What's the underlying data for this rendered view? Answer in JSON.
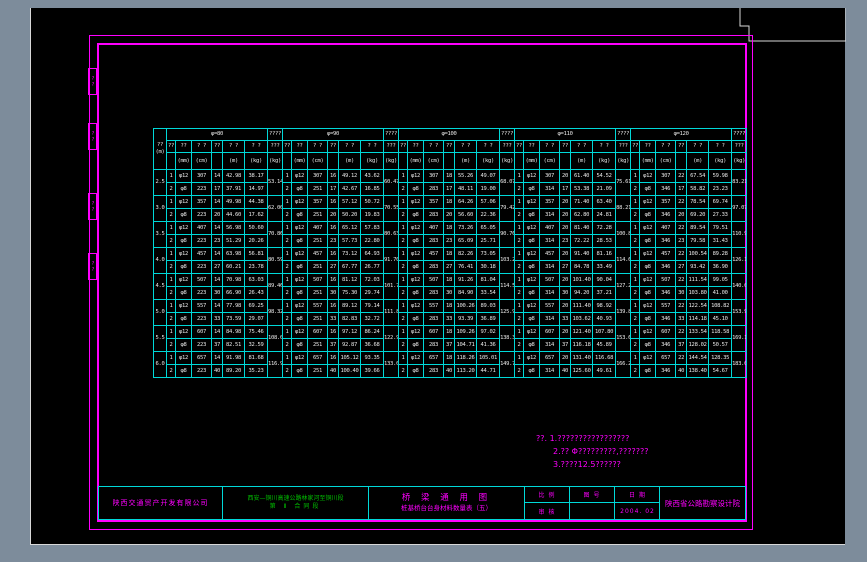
{
  "colors": {
    "desktop_background": "#7D8C9B",
    "drawing_background": "#000000",
    "frame": "#FF00FF",
    "grid": "#00D8D8",
    "table_text": "#E8E8E8",
    "note_text": "#FF00FF",
    "project_text": "#00C000"
  },
  "margin_tabs": [
    "??",
    "??",
    "??",
    "??"
  ],
  "table": {
    "corner_label": "??",
    "corner_unit": "(m)",
    "total_top": "????",
    "total_label": "???",
    "total_unit": "(kg)",
    "col_labels": [
      "??",
      "??",
      "? ?",
      "??",
      "? ?",
      "? ?"
    ],
    "col_units": [
      "",
      "(mm)",
      "(cm)",
      "",
      "(m)",
      "(kg)"
    ],
    "row_labels": [
      "2.5",
      "3.0",
      "3.5",
      "4.0",
      "4.5",
      "5.0",
      "5.5",
      "6.0"
    ],
    "groups": [
      {
        "title": "φ=80",
        "pairs": [
          {
            "r1": [
              "1",
              "φ12",
              "307",
              "14",
              "42.98",
              "38.17"
            ],
            "r2": [
              "2",
              "φ8",
              "223",
              "17",
              "37.91",
              "14.97"
            ],
            "sum": "53.14"
          },
          {
            "r1": [
              "1",
              "φ12",
              "357",
              "14",
              "49.98",
              "44.38"
            ],
            "r2": [
              "2",
              "φ8",
              "223",
              "20",
              "44.60",
              "17.62"
            ],
            "sum": "62.00"
          },
          {
            "r1": [
              "1",
              "φ12",
              "407",
              "14",
              "56.98",
              "50.60"
            ],
            "r2": [
              "2",
              "φ8",
              "223",
              "23",
              "51.29",
              "20.26"
            ],
            "sum": "70.86"
          },
          {
            "r1": [
              "1",
              "φ12",
              "457",
              "14",
              "63.98",
              "56.81"
            ],
            "r2": [
              "2",
              "φ8",
              "223",
              "27",
              "60.21",
              "23.78"
            ],
            "sum": "80.59"
          },
          {
            "r1": [
              "1",
              "φ12",
              "507",
              "14",
              "70.98",
              "63.03"
            ],
            "r2": [
              "2",
              "φ8",
              "223",
              "30",
              "66.90",
              "26.43"
            ],
            "sum": "89.46"
          },
          {
            "r1": [
              "1",
              "φ12",
              "557",
              "14",
              "77.98",
              "69.25"
            ],
            "r2": [
              "2",
              "φ8",
              "223",
              "33",
              "73.59",
              "29.07"
            ],
            "sum": "98.32"
          },
          {
            "r1": [
              "1",
              "φ12",
              "607",
              "14",
              "84.98",
              "75.46"
            ],
            "r2": [
              "2",
              "φ8",
              "223",
              "37",
              "82.51",
              "32.59"
            ],
            "sum": "108.05"
          },
          {
            "r1": [
              "1",
              "φ12",
              "657",
              "14",
              "91.98",
              "81.68"
            ],
            "r2": [
              "2",
              "φ8",
              "223",
              "40",
              "89.20",
              "35.23"
            ],
            "sum": "116.91"
          }
        ]
      },
      {
        "title": "φ=90",
        "pairs": [
          {
            "r1": [
              "1",
              "φ12",
              "307",
              "16",
              "49.12",
              "43.62"
            ],
            "r2": [
              "2",
              "φ8",
              "251",
              "17",
              "42.67",
              "16.85"
            ],
            "sum": "60.47"
          },
          {
            "r1": [
              "1",
              "φ12",
              "357",
              "16",
              "57.12",
              "50.72"
            ],
            "r2": [
              "2",
              "φ8",
              "251",
              "20",
              "50.20",
              "19.83"
            ],
            "sum": "70.55"
          },
          {
            "r1": [
              "1",
              "φ12",
              "407",
              "16",
              "65.12",
              "57.83"
            ],
            "r2": [
              "2",
              "φ8",
              "251",
              "23",
              "57.73",
              "22.80"
            ],
            "sum": "80.63"
          },
          {
            "r1": [
              "1",
              "φ12",
              "457",
              "16",
              "73.12",
              "64.93"
            ],
            "r2": [
              "2",
              "φ8",
              "251",
              "27",
              "67.77",
              "26.77"
            ],
            "sum": "91.70"
          },
          {
            "r1": [
              "1",
              "φ12",
              "507",
              "16",
              "81.12",
              "72.03"
            ],
            "r2": [
              "2",
              "φ8",
              "251",
              "30",
              "75.30",
              "29.74"
            ],
            "sum": "101.77"
          },
          {
            "r1": [
              "1",
              "φ12",
              "557",
              "16",
              "89.12",
              "79.14"
            ],
            "r2": [
              "2",
              "φ8",
              "251",
              "33",
              "82.83",
              "32.72"
            ],
            "sum": "111.86"
          },
          {
            "r1": [
              "1",
              "φ12",
              "607",
              "16",
              "97.12",
              "86.24"
            ],
            "r2": [
              "2",
              "φ8",
              "251",
              "37",
              "92.87",
              "36.68"
            ],
            "sum": "122.92"
          },
          {
            "r1": [
              "1",
              "φ12",
              "657",
              "16",
              "105.12",
              "93.35"
            ],
            "r2": [
              "2",
              "φ8",
              "251",
              "40",
              "100.40",
              "39.66"
            ],
            "sum": "133.01"
          }
        ]
      },
      {
        "title": "φ=100",
        "pairs": [
          {
            "r1": [
              "1",
              "φ12",
              "307",
              "18",
              "55.26",
              "49.07"
            ],
            "r2": [
              "2",
              "φ8",
              "283",
              "17",
              "48.11",
              "19.00"
            ],
            "sum": "68.07"
          },
          {
            "r1": [
              "1",
              "φ12",
              "357",
              "18",
              "64.26",
              "57.06"
            ],
            "r2": [
              "2",
              "φ8",
              "283",
              "20",
              "56.60",
              "22.36"
            ],
            "sum": "79.42"
          },
          {
            "r1": [
              "1",
              "φ12",
              "407",
              "18",
              "73.26",
              "65.05"
            ],
            "r2": [
              "2",
              "φ8",
              "283",
              "23",
              "65.09",
              "25.71"
            ],
            "sum": "90.76"
          },
          {
            "r1": [
              "1",
              "φ12",
              "457",
              "18",
              "82.26",
              "73.05"
            ],
            "r2": [
              "2",
              "φ8",
              "283",
              "27",
              "76.41",
              "30.18"
            ],
            "sum": "103.23"
          },
          {
            "r1": [
              "1",
              "φ12",
              "507",
              "18",
              "91.26",
              "81.04"
            ],
            "r2": [
              "2",
              "φ8",
              "283",
              "30",
              "84.90",
              "33.54"
            ],
            "sum": "114.58"
          },
          {
            "r1": [
              "1",
              "φ12",
              "557",
              "18",
              "100.26",
              "89.03"
            ],
            "r2": [
              "2",
              "φ8",
              "283",
              "33",
              "93.39",
              "36.89"
            ],
            "sum": "125.92"
          },
          {
            "r1": [
              "1",
              "φ12",
              "607",
              "18",
              "109.26",
              "97.02"
            ],
            "r2": [
              "2",
              "φ8",
              "283",
              "37",
              "104.71",
              "41.36"
            ],
            "sum": "138.38"
          },
          {
            "r1": [
              "1",
              "φ12",
              "657",
              "18",
              "118.26",
              "105.01"
            ],
            "r2": [
              "2",
              "φ8",
              "283",
              "40",
              "113.20",
              "44.71"
            ],
            "sum": "149.72"
          }
        ]
      },
      {
        "title": "φ=110",
        "pairs": [
          {
            "r1": [
              "1",
              "φ12",
              "307",
              "20",
              "61.40",
              "54.52"
            ],
            "r2": [
              "2",
              "φ8",
              "314",
              "17",
              "53.38",
              "21.09"
            ],
            "sum": "75.61"
          },
          {
            "r1": [
              "1",
              "φ12",
              "357",
              "20",
              "71.40",
              "63.40"
            ],
            "r2": [
              "2",
              "φ8",
              "314",
              "20",
              "62.80",
              "24.81"
            ],
            "sum": "88.21"
          },
          {
            "r1": [
              "1",
              "φ12",
              "407",
              "20",
              "81.40",
              "72.28"
            ],
            "r2": [
              "2",
              "φ8",
              "314",
              "23",
              "72.22",
              "28.53"
            ],
            "sum": "100.81"
          },
          {
            "r1": [
              "1",
              "φ12",
              "457",
              "20",
              "91.40",
              "81.16"
            ],
            "r2": [
              "2",
              "φ8",
              "314",
              "27",
              "84.78",
              "33.49"
            ],
            "sum": "114.65"
          },
          {
            "r1": [
              "1",
              "φ12",
              "507",
              "20",
              "101.40",
              "90.04"
            ],
            "r2": [
              "2",
              "φ8",
              "314",
              "30",
              "94.20",
              "37.21"
            ],
            "sum": "127.25"
          },
          {
            "r1": [
              "1",
              "φ12",
              "557",
              "20",
              "111.40",
              "98.92"
            ],
            "r2": [
              "2",
              "φ8",
              "314",
              "33",
              "103.62",
              "40.93"
            ],
            "sum": "139.85"
          },
          {
            "r1": [
              "1",
              "φ12",
              "607",
              "20",
              "121.40",
              "107.80"
            ],
            "r2": [
              "2",
              "φ8",
              "314",
              "37",
              "116.18",
              "45.89"
            ],
            "sum": "153.69"
          },
          {
            "r1": [
              "1",
              "φ12",
              "657",
              "20",
              "131.40",
              "116.68"
            ],
            "r2": [
              "2",
              "φ8",
              "314",
              "40",
              "125.60",
              "49.61"
            ],
            "sum": "166.29"
          }
        ]
      },
      {
        "title": "φ=120",
        "pairs": [
          {
            "r1": [
              "1",
              "φ12",
              "307",
              "22",
              "67.54",
              "59.98"
            ],
            "r2": [
              "2",
              "φ8",
              "346",
              "17",
              "58.82",
              "23.23"
            ],
            "sum": "83.21"
          },
          {
            "r1": [
              "1",
              "φ12",
              "357",
              "22",
              "78.54",
              "69.74"
            ],
            "r2": [
              "2",
              "φ8",
              "346",
              "20",
              "69.20",
              "27.33"
            ],
            "sum": "97.07"
          },
          {
            "r1": [
              "1",
              "φ12",
              "407",
              "22",
              "89.54",
              "79.51"
            ],
            "r2": [
              "2",
              "φ8",
              "346",
              "23",
              "79.58",
              "31.43"
            ],
            "sum": "110.94"
          },
          {
            "r1": [
              "1",
              "φ12",
              "457",
              "22",
              "100.54",
              "89.28"
            ],
            "r2": [
              "2",
              "φ8",
              "346",
              "27",
              "93.42",
              "36.90"
            ],
            "sum": "126.18"
          },
          {
            "r1": [
              "1",
              "φ12",
              "507",
              "22",
              "111.54",
              "99.05"
            ],
            "r2": [
              "2",
              "φ8",
              "346",
              "30",
              "103.80",
              "41.00"
            ],
            "sum": "140.05"
          },
          {
            "r1": [
              "1",
              "φ12",
              "557",
              "22",
              "122.54",
              "108.82"
            ],
            "r2": [
              "2",
              "φ8",
              "346",
              "33",
              "114.18",
              "45.10"
            ],
            "sum": "153.92"
          },
          {
            "r1": [
              "1",
              "φ12",
              "607",
              "22",
              "133.54",
              "118.58"
            ],
            "r2": [
              "2",
              "φ8",
              "346",
              "37",
              "128.02",
              "50.57"
            ],
            "sum": "169.15"
          },
          {
            "r1": [
              "1",
              "φ12",
              "657",
              "22",
              "144.54",
              "128.35"
            ],
            "r2": [
              "2",
              "φ8",
              "346",
              "40",
              "138.40",
              "54.67"
            ],
            "sum": "183.02"
          }
        ]
      }
    ]
  },
  "notes": {
    "lines": [
      "??. 1.?????????????????",
      "2.?? Φ?????????,???????",
      "3.????12.5??????"
    ]
  },
  "title_block": {
    "company": "陕西交通贸产开发有限公司",
    "project_line1": "西安—铜川高速公路林家河至铜川段",
    "project_line2": "第 Ⅱ 合同段",
    "drawing_type": "桥 梁 通 用 图",
    "drawing_sheet": "桩基桥台台身材料数量表（五）",
    "fields": {
      "scale_label": "比 例",
      "sheet_label": "图 号",
      "date_label": "日 期",
      "check_label": "审 核",
      "blank": "",
      "date_value": "2004. 02"
    },
    "institute": "陕西省公路勘察设计院"
  }
}
